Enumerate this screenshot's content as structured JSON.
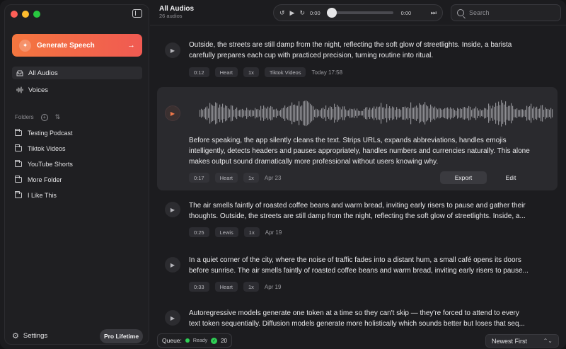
{
  "sidebar": {
    "generate_label": "Generate Speech",
    "nav": [
      {
        "label": "All Audios",
        "icon": "inbox-icon",
        "active": true
      },
      {
        "label": "Voices",
        "icon": "waveform-icon",
        "active": false
      }
    ],
    "folders_label": "Folders",
    "folders": [
      "Testing Podcast",
      "Tiktok Videos",
      "YouTube Shorts",
      "More Folder",
      "I Like This"
    ],
    "settings_label": "Settings",
    "pro_label": "Pro Lifetime"
  },
  "header": {
    "title": "All Audios",
    "subtitle": "26 audios",
    "player": {
      "current": "0:00",
      "total": "0:00"
    },
    "search_placeholder": "Search"
  },
  "audios": [
    {
      "lines": [
        "Outside, the streets are still damp from the night, reflecting the soft glow of streetlights. Inside, a barista",
        "carefully prepares each cup with practiced precision, turning routine into ritual."
      ],
      "duration": "0:12",
      "voice": "Heart",
      "speed": "1x",
      "folder": "Tiktok Videos",
      "date": "Today 17:58"
    },
    {
      "lines": [
        "Before speaking, the app silently cleans the text. Strips URLs, expands abbreviations, handles emojis",
        "intelligently, detects headers and pauses appropriately, handles numbers and currencies naturally. This alone",
        "makes output sound dramatically more professional without users knowing why."
      ],
      "duration": "0:17",
      "voice": "Heart",
      "speed": "1x",
      "date": "Apr 23",
      "export_label": "Export",
      "edit_label": "Edit"
    },
    {
      "lines": [
        "The air smells faintly of roasted coffee beans and warm bread, inviting early risers to pause and gather their",
        "thoughts. Outside, the streets are still damp from the night, reflecting the soft glow of streetlights. Inside, a..."
      ],
      "duration": "0:25",
      "voice": "Lewis",
      "speed": "1x",
      "date": "Apr 19"
    },
    {
      "lines": [
        "In a quiet corner of the city, where the noise of traffic fades into a distant hum, a small café opens its doors",
        "before sunrise. The air smells faintly of roasted coffee beans and warm bread, inviting early risers to pause..."
      ],
      "duration": "0:33",
      "voice": "Heart",
      "speed": "1x",
      "date": "Apr 19"
    },
    {
      "lines": [
        "Autoregressive models generate one token at a time so they can't skip — they're forced to attend to every",
        "text token sequentially. Diffusion models generate more holistically which sounds better but loses that seq..."
      ]
    }
  ],
  "footer": {
    "queue_label": "Queue:",
    "status": "Ready",
    "count": "20",
    "sort": "Newest First"
  },
  "colors": {
    "accent": "#f4763f",
    "accent2": "#f05a52",
    "ready": "#2fcf55"
  }
}
